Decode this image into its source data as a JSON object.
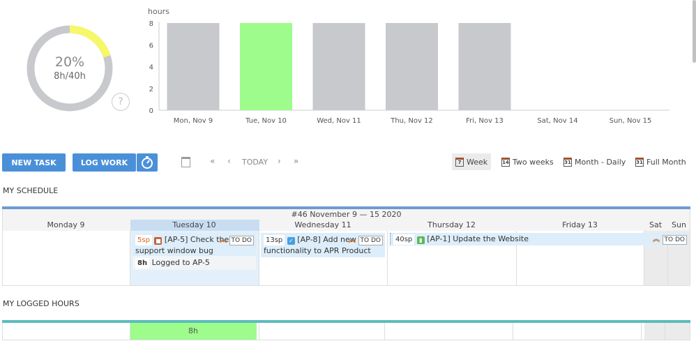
{
  "progress": {
    "percent_label": "20%",
    "hours_label": "8h/40h",
    "fraction": 0.2,
    "help": "?"
  },
  "chart_data": {
    "type": "bar",
    "ylabel": "hours",
    "ylim": [
      0,
      8
    ],
    "yticks": [
      "0",
      "2",
      "4",
      "6",
      "8"
    ],
    "categories": [
      "Mon, Nov 9",
      "Tue, Nov 10",
      "Wed, Nov 11",
      "Thu, Nov 12",
      "Fri, Nov 13",
      "Sat, Nov 14",
      "Sun, Nov 15"
    ],
    "values": [
      8,
      8,
      8,
      8,
      8,
      0,
      0
    ],
    "highlight_index": 1,
    "colors": {
      "default": "#c8c9cc",
      "highlight": "#9dfc8c"
    }
  },
  "toolbar": {
    "new_task": "NEW TASK",
    "log_work": "LOG WORK",
    "today": "TODAY",
    "views": [
      {
        "icon": "7",
        "label": "Week"
      },
      {
        "icon": "14",
        "label": "Two weeks"
      },
      {
        "icon": "31",
        "label": "Month - Daily"
      },
      {
        "icon": "31",
        "label": "Full Month"
      }
    ]
  },
  "schedule": {
    "title": "MY SCHEDULE",
    "week_label": "#46 November 9 — 15 2020",
    "days": [
      "Monday 9",
      "Tuesday 10",
      "Wednesday 11",
      "Thursday 12",
      "Friday 13",
      "Sat",
      "Sun"
    ],
    "tasks": [
      {
        "sp": "5sp",
        "title": "[AP-5] Check the support window bug",
        "status": "TO DO"
      },
      {
        "sp": "13sp",
        "title": "[AP-8] Add new functionality to APR Product",
        "status": "TO DO"
      },
      {
        "sp": "40sp",
        "title": "[AP-1] Update the Website",
        "status": "TO DO"
      }
    ],
    "log": {
      "hours": "8h",
      "label": "Logged to AP-5"
    }
  },
  "logged": {
    "title": "MY LOGGED HOURS",
    "tuesday": "8h"
  },
  "colors": {
    "accent": "#4a90d9",
    "schedule_bar": "#6b9bd2",
    "logged_bar": "#5bbcbc",
    "green": "#9dfc8c",
    "yellow": "#f7f76a"
  }
}
